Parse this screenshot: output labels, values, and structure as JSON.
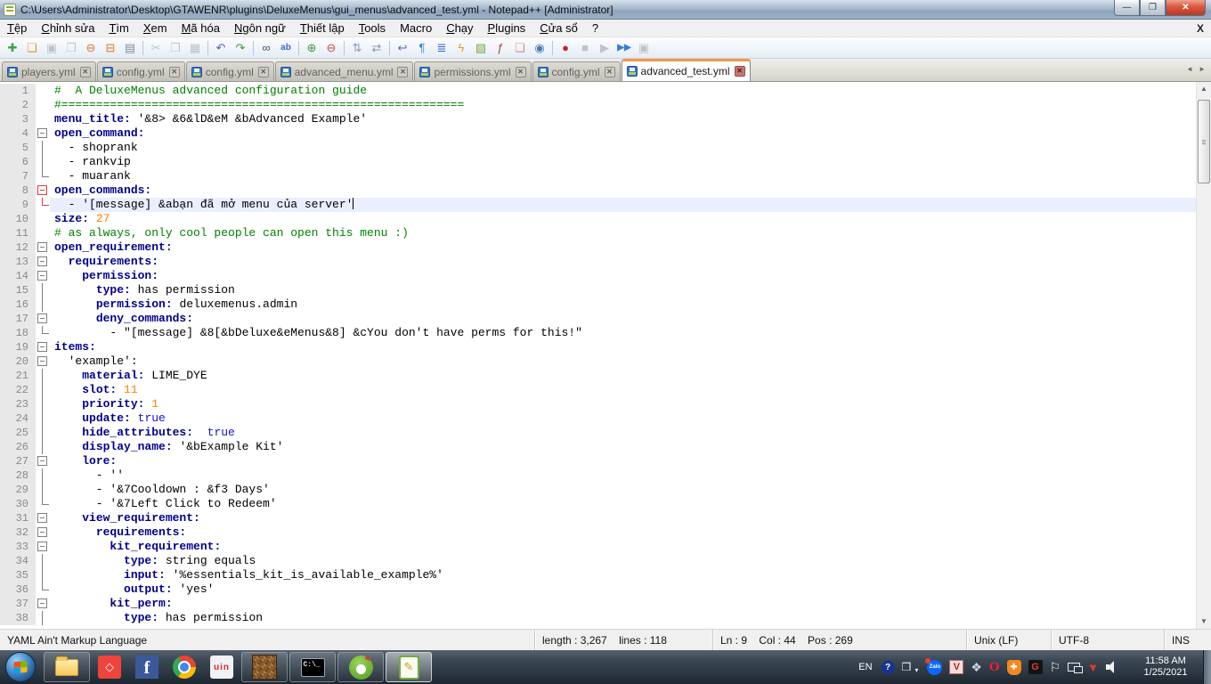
{
  "window": {
    "title": "C:\\Users\\Administrator\\Desktop\\GTAWENR\\plugins\\DeluxeMenus\\gui_menus\\advanced_test.yml - Notepad++ [Administrator]",
    "buttons": {
      "minimize": "—",
      "restore": "❐",
      "close": "✕"
    }
  },
  "menu": {
    "items": [
      "Tệp",
      "Chỉnh sửa",
      "Tìm",
      "Xem",
      "Mã hóa",
      "Ngôn ngữ",
      "Thiết lập",
      "Tools",
      "Macro",
      "Chạy",
      "Plugins",
      "Cửa sổ",
      "?"
    ],
    "close_label": "X"
  },
  "toolbar": {
    "icons": [
      {
        "name": "new-file-icon",
        "g": "✚",
        "c": "#3fa43f"
      },
      {
        "name": "open-file-icon",
        "g": "❏",
        "c": "#d9952e"
      },
      {
        "name": "save-icon",
        "g": "▣",
        "c": "#9a9a9a",
        "d": 1
      },
      {
        "name": "save-all-icon",
        "g": "❐",
        "c": "#9a9a9a",
        "d": 1
      },
      {
        "name": "close-doc-icon",
        "g": "⊖",
        "c": "#e0722a"
      },
      {
        "name": "close-all-docs-icon",
        "g": "⊟",
        "c": "#e0722a"
      },
      {
        "name": "print-icon",
        "g": "▤",
        "c": "#7d8ea3"
      },
      {
        "sep": 1
      },
      {
        "name": "cut-icon",
        "g": "✂",
        "c": "#9a9a9a",
        "d": 1
      },
      {
        "name": "copy-icon",
        "g": "❐",
        "c": "#9a9a9a",
        "d": 1
      },
      {
        "name": "paste-icon",
        "g": "▦",
        "c": "#9a9a9a",
        "d": 1
      },
      {
        "sep": 1
      },
      {
        "name": "undo-icon",
        "g": "↶",
        "c": "#4a5fc9"
      },
      {
        "name": "redo-icon",
        "g": "↷",
        "c": "#3c9c3c"
      },
      {
        "sep": 1
      },
      {
        "name": "find-icon",
        "g": "∞",
        "c": "#3d5a80"
      },
      {
        "name": "replace-icon",
        "g": "ab",
        "c": "#3a6bc9",
        "small": 1
      },
      {
        "sep": 1
      },
      {
        "name": "zoom-in-icon",
        "g": "⊕",
        "c": "#3c9c3c"
      },
      {
        "name": "zoom-out-icon",
        "g": "⊖",
        "c": "#c94a4a"
      },
      {
        "sep": 1
      },
      {
        "name": "sync-vertical-icon",
        "g": "⇅",
        "c": "#8a97b5"
      },
      {
        "name": "sync-horizontal-icon",
        "g": "⇄",
        "c": "#8a97b5"
      },
      {
        "sep": 1
      },
      {
        "name": "word-wrap-icon",
        "g": "↩",
        "c": "#4a6fd0"
      },
      {
        "name": "show-all-chars-icon",
        "g": "¶",
        "c": "#3a7bd5"
      },
      {
        "name": "indent-guide-icon",
        "g": "≣",
        "c": "#2a5fd0"
      },
      {
        "name": "user-lang-icon",
        "g": "ϟ",
        "c": "#d9a21f"
      },
      {
        "name": "doc-map-icon",
        "g": "▧",
        "c": "#7fa84f"
      },
      {
        "name": "function-list-icon",
        "g": "ƒ",
        "c": "#b03a3a"
      },
      {
        "name": "folder-workspace-icon",
        "g": "❏",
        "c": "#d98a8a"
      },
      {
        "name": "monitoring-icon",
        "g": "◉",
        "c": "#4a7bb5"
      },
      {
        "sep": 1
      },
      {
        "name": "record-macro-icon",
        "g": "●",
        "c": "#c42222"
      },
      {
        "name": "stop-macro-icon",
        "g": "■",
        "c": "#9a9a9a",
        "d": 1
      },
      {
        "name": "play-macro-icon",
        "g": "▶",
        "c": "#9a9a9a",
        "d": 1
      },
      {
        "name": "multi-play-macro-icon",
        "g": "▶▶",
        "c": "#3a7bd5",
        "small": 1
      },
      {
        "name": "save-macro-icon",
        "g": "▣",
        "c": "#9a9a9a",
        "d": 1
      }
    ]
  },
  "tabs": {
    "items": [
      {
        "label": "players.yml",
        "active": false
      },
      {
        "label": "config.yml",
        "active": false
      },
      {
        "label": "config.yml",
        "active": false
      },
      {
        "label": "advanced_menu.yml",
        "active": false
      },
      {
        "label": "permissions.yml",
        "active": false
      },
      {
        "label": "config.yml",
        "active": false
      },
      {
        "label": "advanced_test.yml",
        "active": true
      }
    ],
    "close_glyph": "✕",
    "nav_arrows": "◄ ►"
  },
  "editor": {
    "lines": [
      {
        "n": 1,
        "fold": null,
        "segs": [
          {
            "t": "#  A DeluxeMenus advanced configuration guide",
            "c": "com"
          }
        ]
      },
      {
        "n": 2,
        "fold": null,
        "segs": [
          {
            "t": "#==========================================================",
            "c": "com"
          }
        ]
      },
      {
        "n": 3,
        "fold": null,
        "segs": [
          {
            "t": "menu_title:",
            "c": "key"
          },
          {
            "t": " '&8> &6&lD&eM &bAdvanced Example'",
            "c": "txt"
          }
        ]
      },
      {
        "n": 4,
        "fold": "box",
        "segs": [
          {
            "t": "open_command:",
            "c": "key"
          }
        ]
      },
      {
        "n": 5,
        "fold": "v",
        "segs": [
          {
            "t": "  - shoprank",
            "c": "txt"
          }
        ]
      },
      {
        "n": 6,
        "fold": "v",
        "segs": [
          {
            "t": "  - rankvip",
            "c": "txt"
          }
        ]
      },
      {
        "n": 7,
        "fold": "c",
        "segs": [
          {
            "t": "  - muarank",
            "c": "txt"
          }
        ]
      },
      {
        "n": 8,
        "fold": "box",
        "red": true,
        "segs": [
          {
            "t": "open_commands:",
            "c": "key"
          }
        ]
      },
      {
        "n": 9,
        "fold": "c",
        "red": true,
        "hl": true,
        "caret": true,
        "segs": [
          {
            "t": "  - '[message] &abạn đã mở menu của server'",
            "c": "txt"
          }
        ]
      },
      {
        "n": 10,
        "fold": null,
        "segs": [
          {
            "t": "size:",
            "c": "key"
          },
          {
            "t": " ",
            "c": "txt"
          },
          {
            "t": "27",
            "c": "numtok"
          }
        ]
      },
      {
        "n": 11,
        "fold": null,
        "segs": [
          {
            "t": "# as always, only cool people can open this menu :)",
            "c": "com"
          }
        ]
      },
      {
        "n": 12,
        "fold": "box",
        "segs": [
          {
            "t": "open_requirement:",
            "c": "key"
          }
        ]
      },
      {
        "n": 13,
        "fold": "box",
        "segs": [
          {
            "t": "  ",
            "c": "txt"
          },
          {
            "t": "requirements:",
            "c": "key"
          }
        ]
      },
      {
        "n": 14,
        "fold": "box",
        "segs": [
          {
            "t": "    ",
            "c": "txt"
          },
          {
            "t": "permission:",
            "c": "key"
          }
        ]
      },
      {
        "n": 15,
        "fold": "v",
        "segs": [
          {
            "t": "      ",
            "c": "txt"
          },
          {
            "t": "type:",
            "c": "key"
          },
          {
            "t": " has permission",
            "c": "txt"
          }
        ]
      },
      {
        "n": 16,
        "fold": "v",
        "segs": [
          {
            "t": "      ",
            "c": "txt"
          },
          {
            "t": "permission:",
            "c": "key"
          },
          {
            "t": " deluxemenus.admin",
            "c": "txt"
          }
        ]
      },
      {
        "n": 17,
        "fold": "box",
        "segs": [
          {
            "t": "      ",
            "c": "txt"
          },
          {
            "t": "deny_commands:",
            "c": "key"
          }
        ]
      },
      {
        "n": 18,
        "fold": "c",
        "segs": [
          {
            "t": "        - \"[message] &8[&bDeluxe&eMenus&8] &cYou don't have perms for this!\"",
            "c": "txt"
          }
        ]
      },
      {
        "n": 19,
        "fold": "box",
        "segs": [
          {
            "t": "items:",
            "c": "key"
          }
        ]
      },
      {
        "n": 20,
        "fold": "box",
        "segs": [
          {
            "t": "  'example':",
            "c": "txt"
          }
        ]
      },
      {
        "n": 21,
        "fold": "v",
        "segs": [
          {
            "t": "    ",
            "c": "txt"
          },
          {
            "t": "material:",
            "c": "key"
          },
          {
            "t": " LIME_DYE",
            "c": "txt"
          }
        ]
      },
      {
        "n": 22,
        "fold": "v",
        "segs": [
          {
            "t": "    ",
            "c": "txt"
          },
          {
            "t": "slot:",
            "c": "key"
          },
          {
            "t": " ",
            "c": "txt"
          },
          {
            "t": "11",
            "c": "numtok"
          }
        ]
      },
      {
        "n": 23,
        "fold": "v",
        "segs": [
          {
            "t": "    ",
            "c": "txt"
          },
          {
            "t": "priority:",
            "c": "key"
          },
          {
            "t": " ",
            "c": "txt"
          },
          {
            "t": "1",
            "c": "numtok"
          }
        ]
      },
      {
        "n": 24,
        "fold": "v",
        "segs": [
          {
            "t": "    ",
            "c": "txt"
          },
          {
            "t": "update:",
            "c": "key"
          },
          {
            "t": " ",
            "c": "txt"
          },
          {
            "t": "true",
            "c": "booltok"
          }
        ]
      },
      {
        "n": 25,
        "fold": "v",
        "segs": [
          {
            "t": "    ",
            "c": "txt"
          },
          {
            "t": "hide_attributes:",
            "c": "key"
          },
          {
            "t": "  ",
            "c": "txt"
          },
          {
            "t": "true",
            "c": "booltok"
          }
        ]
      },
      {
        "n": 26,
        "fold": "v",
        "segs": [
          {
            "t": "    ",
            "c": "txt"
          },
          {
            "t": "display_name:",
            "c": "key"
          },
          {
            "t": " '&bExample Kit'",
            "c": "txt"
          }
        ]
      },
      {
        "n": 27,
        "fold": "box",
        "segs": [
          {
            "t": "    ",
            "c": "txt"
          },
          {
            "t": "lore:",
            "c": "key"
          }
        ]
      },
      {
        "n": 28,
        "fold": "v",
        "segs": [
          {
            "t": "      - ''",
            "c": "txt"
          }
        ]
      },
      {
        "n": 29,
        "fold": "v",
        "segs": [
          {
            "t": "      - '&7Cooldown : &f3 Days'",
            "c": "txt"
          }
        ]
      },
      {
        "n": 30,
        "fold": "c",
        "segs": [
          {
            "t": "      - '&7Left Click to Redeem'",
            "c": "txt"
          }
        ]
      },
      {
        "n": 31,
        "fold": "box",
        "segs": [
          {
            "t": "    ",
            "c": "txt"
          },
          {
            "t": "view_requirement:",
            "c": "key"
          }
        ]
      },
      {
        "n": 32,
        "fold": "box",
        "segs": [
          {
            "t": "      ",
            "c": "txt"
          },
          {
            "t": "requirements:",
            "c": "key"
          }
        ]
      },
      {
        "n": 33,
        "fold": "box",
        "segs": [
          {
            "t": "        ",
            "c": "txt"
          },
          {
            "t": "kit_requirement:",
            "c": "key"
          }
        ]
      },
      {
        "n": 34,
        "fold": "v",
        "segs": [
          {
            "t": "          ",
            "c": "txt"
          },
          {
            "t": "type:",
            "c": "key"
          },
          {
            "t": " string equals",
            "c": "txt"
          }
        ]
      },
      {
        "n": 35,
        "fold": "v",
        "segs": [
          {
            "t": "          ",
            "c": "txt"
          },
          {
            "t": "input:",
            "c": "key"
          },
          {
            "t": " '%essentials_kit_is_available_example%'",
            "c": "txt"
          }
        ]
      },
      {
        "n": 36,
        "fold": "c",
        "segs": [
          {
            "t": "          ",
            "c": "txt"
          },
          {
            "t": "output:",
            "c": "key"
          },
          {
            "t": " 'yes'",
            "c": "txt"
          }
        ]
      },
      {
        "n": 37,
        "fold": "box",
        "segs": [
          {
            "t": "        ",
            "c": "txt"
          },
          {
            "t": "kit_perm:",
            "c": "key"
          }
        ]
      },
      {
        "n": 38,
        "fold": "v",
        "segs": [
          {
            "t": "          ",
            "c": "txt"
          },
          {
            "t": "type:",
            "c": "key"
          },
          {
            "t": " has permission",
            "c": "txt"
          }
        ]
      }
    ]
  },
  "status_bar": {
    "doc_type": "YAML Ain't Markup Language",
    "length_info": "length : 3,267    lines : 118",
    "cursor_info": "Ln : 9    Col : 44    Pos : 269",
    "eol": "Unix (LF)",
    "encoding": "UTF-8",
    "mode": "INS"
  },
  "taskbar": {
    "apps": [
      {
        "name": "start-button",
        "kind": "start",
        "open": false,
        "active": false
      },
      {
        "name": "taskbar-explorer",
        "kind": "explorer",
        "open": true,
        "active": false
      },
      {
        "name": "taskbar-anydesk",
        "kind": "anydesk",
        "g": "◇",
        "open": false,
        "active": false
      },
      {
        "name": "taskbar-facebook",
        "kind": "facebook",
        "g": "f",
        "open": false,
        "active": false
      },
      {
        "name": "taskbar-chrome",
        "kind": "chrome",
        "open": false,
        "active": false
      },
      {
        "name": "taskbar-unikey",
        "kind": "unikey",
        "g": "uin",
        "open": false,
        "active": false
      },
      {
        "name": "taskbar-minecraft",
        "kind": "minecraft",
        "open": true,
        "active": false
      },
      {
        "name": "taskbar-cmd",
        "kind": "cmd",
        "g": "C:\\_",
        "open": true,
        "active": false
      },
      {
        "name": "taskbar-coccoc",
        "kind": "coccoc",
        "open": true,
        "active": false
      },
      {
        "name": "taskbar-notepadpp",
        "kind": "npp",
        "open": true,
        "active": true
      }
    ],
    "tray": {
      "language": "EN",
      "icons": [
        {
          "name": "help-tray-icon",
          "kind": "help",
          "g": "?"
        },
        {
          "name": "tray-window-icon",
          "kind": "traywin",
          "g": "❒"
        },
        {
          "name": "tray-expand-icon",
          "kind": "caret",
          "g": "▾"
        },
        {
          "name": "zalo-tray-icon",
          "kind": "zalo",
          "g": "Zalo"
        },
        {
          "name": "vkey-tray-icon",
          "kind": "vkey",
          "g": "V"
        },
        {
          "name": "dropbox-tray-icon",
          "kind": "dropbox",
          "g": "❖"
        },
        {
          "name": "opera-tray-icon",
          "kind": "opera",
          "g": "O"
        },
        {
          "name": "antivirus-shield-icon",
          "kind": "shield",
          "g": "✚"
        },
        {
          "name": "garena-tray-icon",
          "kind": "garena",
          "g": "G"
        },
        {
          "name": "action-center-flag-icon",
          "kind": "flag",
          "g": "⚐"
        },
        {
          "name": "network-tray-icon",
          "kind": "network",
          "g": ""
        },
        {
          "name": "download-manager-icon",
          "kind": "idm",
          "g": "▼"
        },
        {
          "name": "volume-tray-icon",
          "kind": "volume",
          "g": ""
        }
      ],
      "time": "11:58 AM",
      "date": "1/25/2021"
    }
  }
}
